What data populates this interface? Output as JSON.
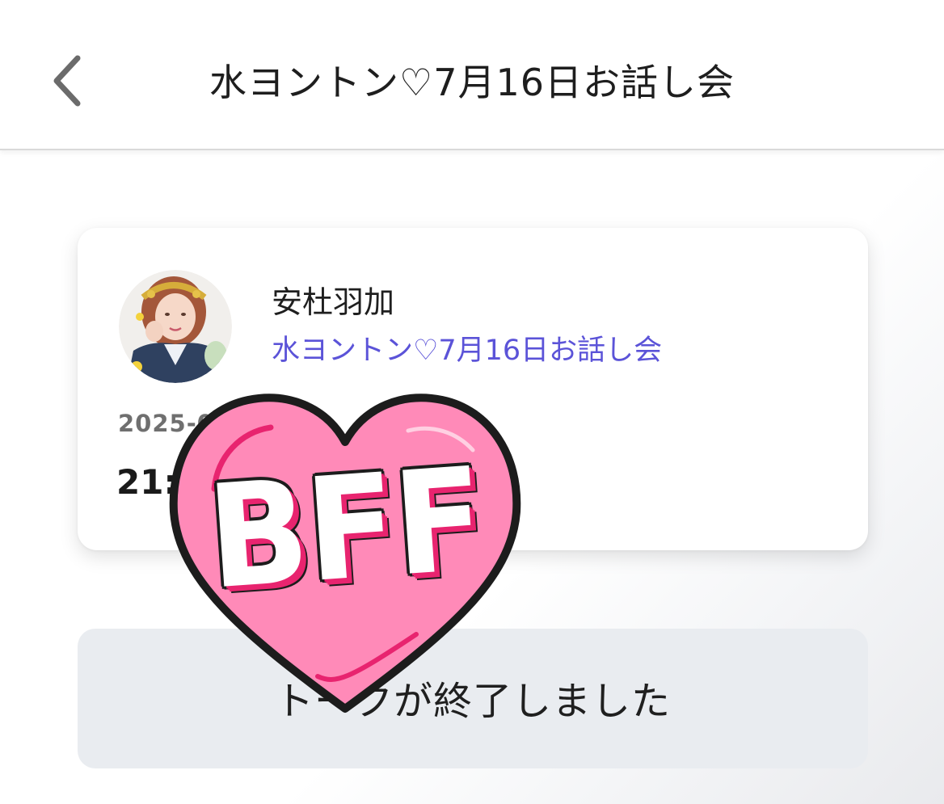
{
  "header": {
    "back_icon": "chevron-left-icon",
    "title": "水ヨントン♡7月16日お話し会"
  },
  "card": {
    "avatar_icon": "profile-photo",
    "name": "安杜羽加",
    "event_title": "水ヨントン♡7月16日お話し会",
    "date_visible": "2025-0",
    "time_visible": "21:"
  },
  "status": {
    "ended_text": "トークが終了しました"
  },
  "sticker": {
    "text": "BFF",
    "shape": "heart",
    "fill_color": "#ff8ab8",
    "accent_color": "#e8246f"
  },
  "colors": {
    "link": "#5b53d8",
    "ended_bg": "#e9ecf0"
  }
}
